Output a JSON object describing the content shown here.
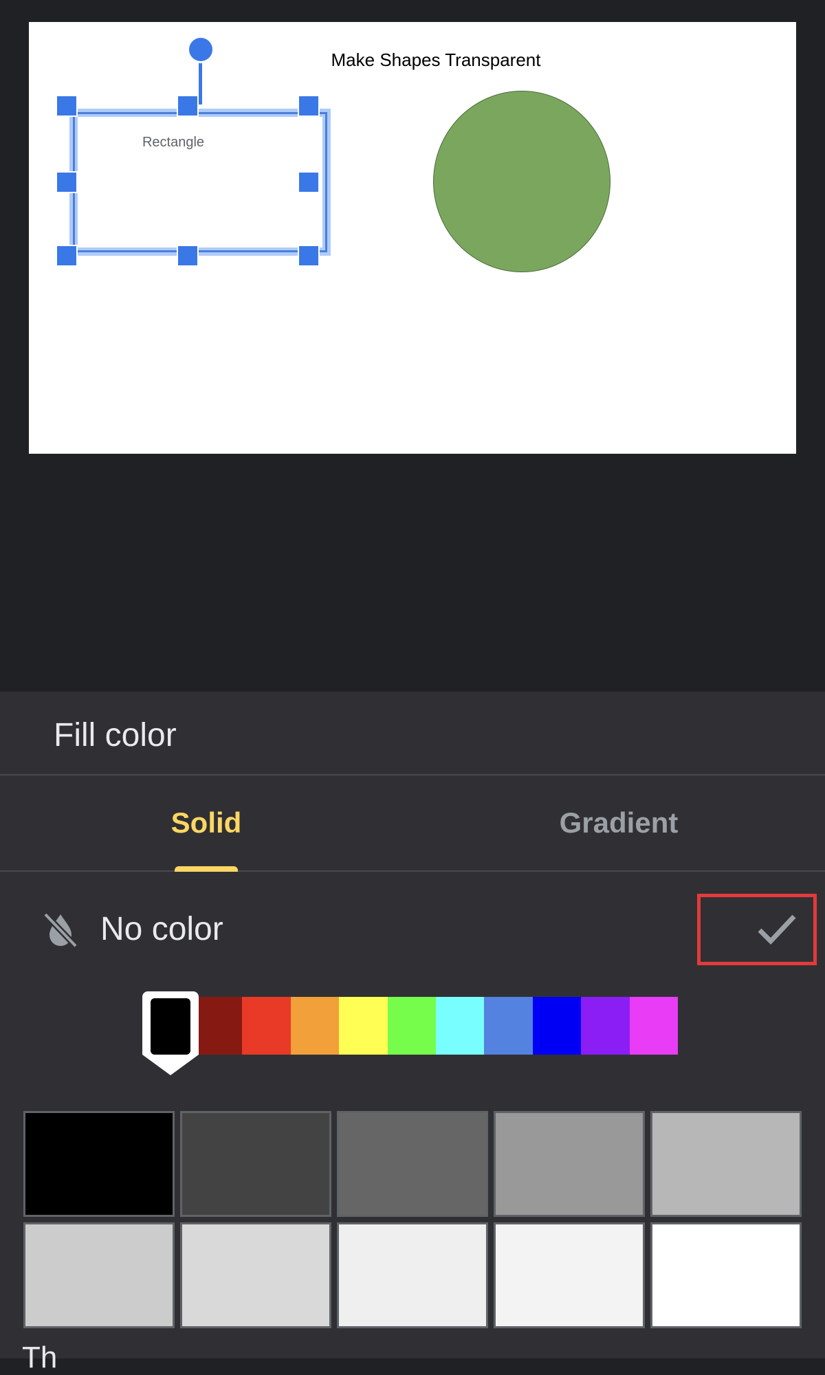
{
  "slide": {
    "title": "Make Shapes Transparent",
    "rectangle_label": "Rectangle",
    "circle_color": "#7aa75d",
    "selection_color": "#3b78e7"
  },
  "sheet": {
    "title": "Fill color",
    "tabs": [
      {
        "label": "Solid",
        "active": true
      },
      {
        "label": "Gradient",
        "active": false
      }
    ],
    "no_color_label": "No color",
    "no_color_selected": true,
    "hues": [
      "#000000",
      "#861a13",
      "#e83a26",
      "#f2a03a",
      "#fffe54",
      "#76fd4b",
      "#78feff",
      "#5382e1",
      "#0000f5",
      "#8a1ef5",
      "#e83cf7"
    ],
    "selected_hue": "#000000",
    "swatches": [
      "#000000",
      "#434343",
      "#666666",
      "#999999",
      "#b7b7b7",
      "#cccccc",
      "#d9d9d9",
      "#efefef",
      "#f3f3f3",
      "#ffffff"
    ],
    "next_section_label": "Th"
  },
  "colors": {
    "accent": "#fdd663",
    "highlight_box": "#e33a3a",
    "sheet_bg": "#303034",
    "app_bg": "#202124"
  }
}
